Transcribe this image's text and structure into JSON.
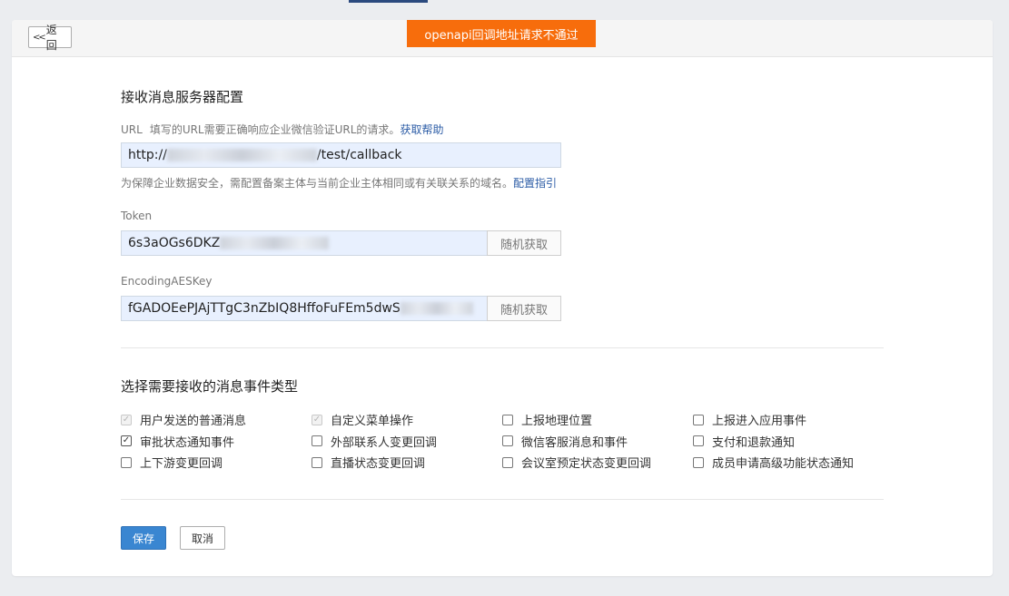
{
  "header": {
    "back_label": "返回",
    "back_icon": "double-chevron-left-icon",
    "alert_text": "openapi回调地址请求不通过",
    "alert_color": "#f76d0c"
  },
  "server_config": {
    "title": "接收消息服务器配置",
    "url": {
      "label": "URL",
      "hint": "填写的URL需要正确响应企业微信验证URL的请求。",
      "help_link": "获取帮助",
      "value_prefix": "http://",
      "value_suffix": "/test/callback",
      "note": "为保障企业数据安全，需配置备案主体与当前企业主体相同或有关联关系的域名。",
      "note_link": "配置指引"
    },
    "token": {
      "label": "Token",
      "value": "6s3aOGs6DKZ",
      "random_button": "随机获取"
    },
    "aes_key": {
      "label": "EncodingAESKey",
      "value": "fGADOEePJAjTTgC3nZbIQ8HffoFuFEm5dwS",
      "random_button": "随机获取"
    }
  },
  "events": {
    "title": "选择需要接收的消息事件类型",
    "items": [
      {
        "label": "用户发送的普通消息",
        "checked": true,
        "disabled": true
      },
      {
        "label": "自定义菜单操作",
        "checked": true,
        "disabled": true
      },
      {
        "label": "上报地理位置",
        "checked": false,
        "disabled": false
      },
      {
        "label": "上报进入应用事件",
        "checked": false,
        "disabled": false
      },
      {
        "label": "审批状态通知事件",
        "checked": true,
        "disabled": false
      },
      {
        "label": "外部联系人变更回调",
        "checked": false,
        "disabled": false
      },
      {
        "label": "微信客服消息和事件",
        "checked": false,
        "disabled": false
      },
      {
        "label": "支付和退款通知",
        "checked": false,
        "disabled": false
      },
      {
        "label": "上下游变更回调",
        "checked": false,
        "disabled": false
      },
      {
        "label": "直播状态变更回调",
        "checked": false,
        "disabled": false
      },
      {
        "label": "会议室预定状态变更回调",
        "checked": false,
        "disabled": false
      },
      {
        "label": "成员申请高级功能状态通知",
        "checked": false,
        "disabled": false
      }
    ]
  },
  "actions": {
    "save_label": "保存",
    "cancel_label": "取消",
    "primary_color": "#3a86d1"
  }
}
